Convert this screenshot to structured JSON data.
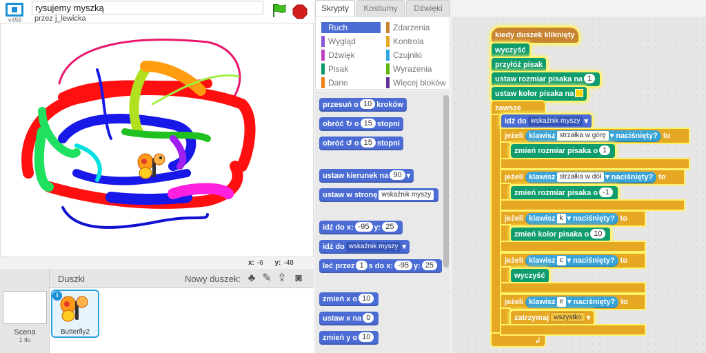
{
  "app": {
    "version": "v456"
  },
  "project": {
    "title": "rysujemy myszką",
    "author": "przez j_lewicka"
  },
  "stage": {
    "coords": {
      "x_label": "x:",
      "x": "-6",
      "y_label": "y:",
      "y": "-48"
    }
  },
  "sprites": {
    "title": "Duszki",
    "new_sprite_label": "Nowy duszek:",
    "scene": {
      "label": "Scena",
      "sub": "1 tło"
    },
    "selected": {
      "name": "Butterfly2"
    }
  },
  "tabs": [
    "Skrypty",
    "Kostiumy",
    "Dźwięki"
  ],
  "categories": [
    {
      "label": "Ruch",
      "color": "#4a6cd4"
    },
    {
      "label": "Zdarzenia",
      "color": "#c88330"
    },
    {
      "label": "Wygląd",
      "color": "#8a55d7"
    },
    {
      "label": "Kontrola",
      "color": "#e6a822"
    },
    {
      "label": "Dźwięk",
      "color": "#bb42c3"
    },
    {
      "label": "Czujniki",
      "color": "#2ca5e2"
    },
    {
      "label": "Pisak",
      "color": "#0e9a6c"
    },
    {
      "label": "Wyrażenia",
      "color": "#5cb712"
    },
    {
      "label": "Dane",
      "color": "#ee7d16"
    },
    {
      "label": "Więcej bloków",
      "color": "#632d99"
    }
  ],
  "palette": {
    "move": {
      "a": "przesuń o",
      "n": "10",
      "b": "kroków"
    },
    "turn_right": {
      "a": "obróć",
      "n": "15",
      "b": "stopni"
    },
    "turn_left": {
      "a": "obróć",
      "n": "15",
      "b": "stopni"
    },
    "point_dir": {
      "a": "ustaw kierunek na",
      "n": "90"
    },
    "point_towards": {
      "a": "ustaw w stronę",
      "dd": "wskaźnik myszy"
    },
    "goto_xy": {
      "a": "idź do x:",
      "x": "-95",
      "b": "y:",
      "y": "25"
    },
    "goto": {
      "a": "idź do",
      "dd": "wskaźnik myszy"
    },
    "glide": {
      "a": "leć przez",
      "n": "1",
      "b": "s do x:",
      "x": "-95",
      "c": "y:",
      "y": "25"
    },
    "change_x": {
      "a": "zmień x o",
      "n": "10"
    },
    "set_x": {
      "a": "ustaw x na",
      "n": "0"
    },
    "change_y": {
      "a": "zmień y o",
      "n": "10"
    }
  },
  "script": {
    "hat": "kiedy duszek kliknięty",
    "clear": "wyczyść",
    "pen_down": "przyłóż pisak",
    "set_size": {
      "a": "ustaw rozmiar pisaka na",
      "n": "1"
    },
    "set_color": {
      "a": "ustaw kolor pisaka na",
      "color": "#ffd400"
    },
    "forever": "zawsze",
    "goto": {
      "a": "idź do",
      "dd": "wskaźnik myszy"
    },
    "if1": {
      "a": "jeżeli",
      "k": "klawisz",
      "dd": "strzałka w górę",
      "p": "naciśnięty?",
      "t": "to"
    },
    "body1": {
      "a": "zmień rozmiar pisaka o",
      "n": "1"
    },
    "if2": {
      "a": "jeżeli",
      "k": "klawisz",
      "dd": "strzałka w dół",
      "p": "naciśnięty?",
      "t": "to"
    },
    "body2": {
      "a": "zmień rozmiar pisaka o",
      "n": "-1"
    },
    "if3": {
      "a": "jeżeli",
      "k": "klawisz",
      "dd": "k",
      "p": "naciśnięty?",
      "t": "to"
    },
    "body3": {
      "a": "zmień kolor pisaka o",
      "n": "10"
    },
    "if4": {
      "a": "jeżeli",
      "k": "klawisz",
      "dd": "c",
      "p": "naciśnięty?",
      "t": "to"
    },
    "body4": "wyczyść",
    "if5": {
      "a": "jeżeli",
      "k": "klawisz",
      "dd": "e",
      "p": "naciśnięty?",
      "t": "to"
    },
    "body5": {
      "a": "zatrzymaj",
      "dd": "wszystko"
    }
  }
}
